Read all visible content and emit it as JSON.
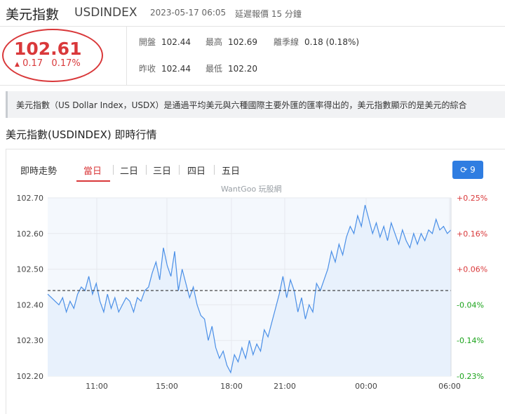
{
  "header": {
    "name": "美元指數",
    "symbol": "USDINDEX",
    "timestamp": "2023-05-17 06:05",
    "delay_note": "延遲報價 15 分鐘"
  },
  "quote": {
    "price": "102.61",
    "change_arrow": "▲",
    "change": "0.17",
    "change_pct": "0.17%",
    "open_label": "開盤",
    "open": "102.44",
    "high_label": "最高",
    "high": "102.69",
    "season_label": "離季線",
    "season": "0.18 (0.18%)",
    "prev_label": "昨收",
    "prev": "102.44",
    "low_label": "最低",
    "low": "102.20"
  },
  "description": "美元指數（US Dollar Index，USDX）是通過平均美元與六種國際主要外匯的匯率得出的，美元指數顯示的是美元的綜合",
  "section_title": "美元指數(USDINDEX) 即時行情",
  "chart_tabs": {
    "label": "即時走勢",
    "tabs": [
      "當日",
      "二日",
      "三日",
      "四日",
      "五日"
    ],
    "active": "當日",
    "refresh_count": "9",
    "watermark": "WantGoo 玩股網"
  },
  "colors": {
    "up": "#d9383a",
    "down": "#1aa31a",
    "line": "#4a8fe7",
    "accent": "#2f7de1"
  },
  "chart_data": {
    "type": "area",
    "x_ticks": [
      "11:00",
      "15:00",
      "18:00",
      "21:00",
      "00:00",
      "06:00"
    ],
    "y_ticks": [
      "102.70",
      "102.60",
      "102.50",
      "102.40",
      "102.30",
      "102.20"
    ],
    "pct_ticks": [
      "+0.25%",
      "+0.16%",
      "+0.06%",
      "-0.04%",
      "-0.14%",
      "-0.23%"
    ],
    "ylim": [
      102.2,
      102.7
    ],
    "reference": 102.44,
    "grid": true,
    "series": [
      {
        "values": [
          102.43,
          102.42,
          102.41,
          102.4,
          102.42,
          102.38,
          102.41,
          102.39,
          102.43,
          102.45,
          102.44,
          102.48,
          102.43,
          102.46,
          102.41,
          102.38,
          102.43,
          102.39,
          102.42,
          102.38,
          102.4,
          102.42,
          102.41,
          102.38,
          102.42,
          102.41,
          102.44,
          102.45,
          102.49,
          102.52,
          102.47,
          102.56,
          102.51,
          102.48,
          102.55,
          102.44,
          102.5,
          102.46,
          102.42,
          102.45,
          102.4,
          102.37,
          102.36,
          102.3,
          102.34,
          102.28,
          102.25,
          102.27,
          102.23,
          102.21,
          102.26,
          102.24,
          102.28,
          102.25,
          102.3,
          102.26,
          102.29,
          102.27,
          102.33,
          102.31,
          102.35,
          102.39,
          102.43,
          102.48,
          102.42,
          102.47,
          102.44,
          102.38,
          102.42,
          102.36,
          102.4,
          102.38,
          102.46,
          102.44,
          102.47,
          102.5,
          102.55,
          102.52,
          102.57,
          102.54,
          102.59,
          102.62,
          102.6,
          102.65,
          102.62,
          102.68,
          102.64,
          102.6,
          102.63,
          102.59,
          102.62,
          102.58,
          102.63,
          102.6,
          102.57,
          102.61,
          102.58,
          102.56,
          102.6,
          102.57,
          102.6,
          102.58,
          102.61,
          102.6,
          102.64,
          102.61,
          102.62,
          102.6,
          102.61
        ]
      }
    ]
  }
}
